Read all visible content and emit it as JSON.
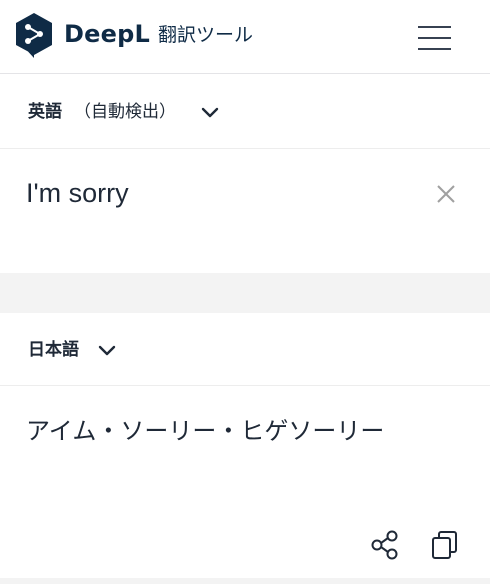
{
  "header": {
    "brand": "DeepL",
    "subtitle": "翻訳ツール"
  },
  "source": {
    "language": "英語",
    "detect_label": "（自動検出）",
    "text": "I'm sorry"
  },
  "target": {
    "language": "日本語",
    "text": "アイム・ソーリー・ヒゲソーリー"
  },
  "colors": {
    "brand_navy": "#0f2b46",
    "text": "#1f2937",
    "divider": "#f3f3f3"
  },
  "icons": {
    "logo": "deepl-logo-icon",
    "menu": "hamburger-menu-icon",
    "clear": "close-icon",
    "share": "share-icon",
    "copy": "copy-icon",
    "chevron": "chevron-down-icon"
  }
}
